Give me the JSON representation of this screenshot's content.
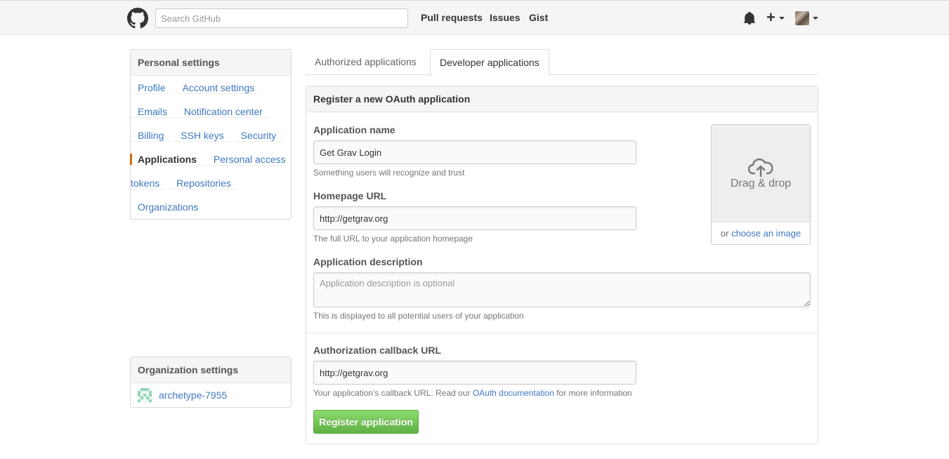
{
  "header": {
    "search_placeholder": "Search GitHub",
    "nav": {
      "pull_requests": "Pull requests",
      "issues": "Issues",
      "gist": "Gist"
    },
    "plus": "+"
  },
  "sidebar": {
    "personal_heading": "Personal settings",
    "items": [
      {
        "label": "Profile"
      },
      {
        "label": "Account settings"
      },
      {
        "label": "Emails"
      },
      {
        "label": "Notification center"
      },
      {
        "label": "Billing"
      },
      {
        "label": "SSH keys"
      },
      {
        "label": "Security"
      },
      {
        "label": "Applications",
        "selected": true
      },
      {
        "label": "Personal access tokens"
      },
      {
        "label": "Repositories"
      },
      {
        "label": "Organizations"
      }
    ],
    "org_heading": "Organization settings",
    "org_name": "archetype-7955"
  },
  "tabs": {
    "authorized": "Authorized applications",
    "developer": "Developer applications"
  },
  "form": {
    "title": "Register a new OAuth application",
    "app_name_label": "Application name",
    "app_name_value": "Get Grav Login",
    "app_name_note": "Something users will recognize and trust",
    "homepage_label": "Homepage URL",
    "homepage_value": "http://getgrav.org",
    "homepage_note": "The full URL to your application homepage",
    "description_label": "Application description",
    "description_placeholder": "Application description is optional",
    "description_note": "This is displayed to all potential users of your application",
    "callback_label": "Authorization callback URL",
    "callback_value": "http://getgrav.org",
    "callback_note_prefix": "Your application’s callback URL. Read our ",
    "callback_note_link": "OAuth documentation",
    "callback_note_suffix": " for more information",
    "drop_text": "Drag & drop",
    "choose_prefix": "or ",
    "choose_link": "choose an image",
    "submit": "Register application"
  },
  "colors": {
    "accent_selected": "#d26911",
    "link": "#4078c0",
    "button_green": "#60b044"
  }
}
